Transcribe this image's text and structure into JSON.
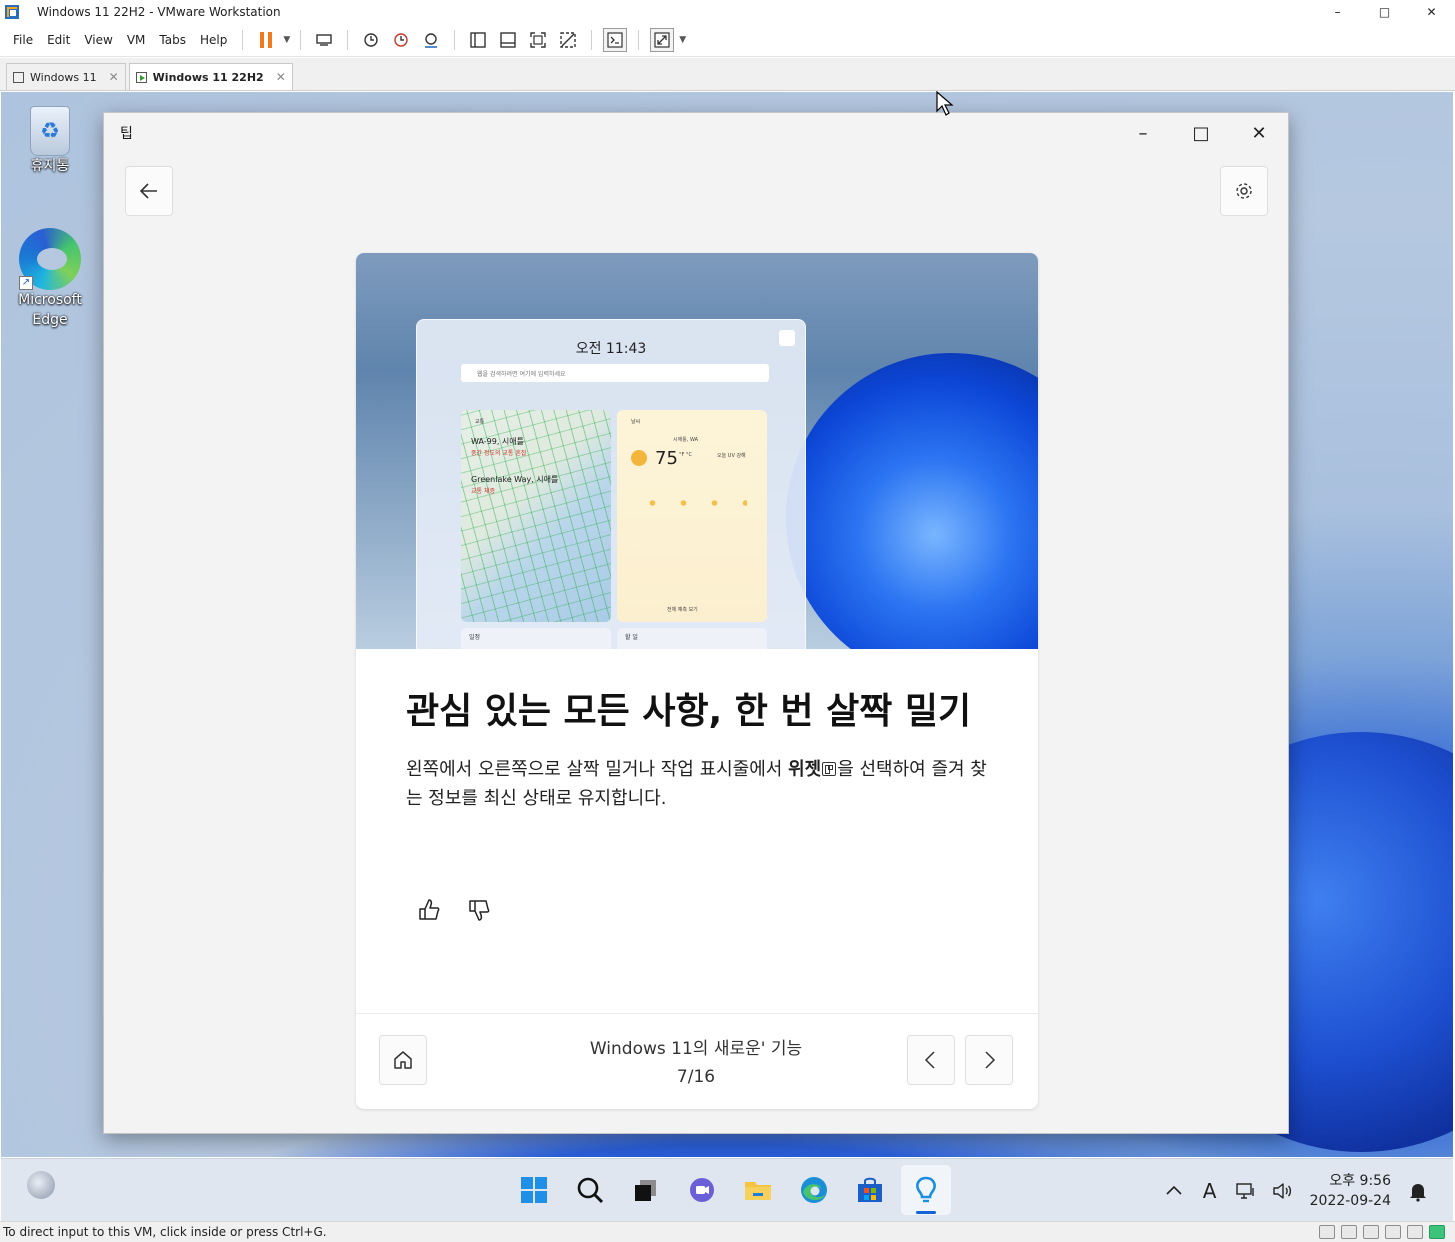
{
  "vm": {
    "window_title": "Windows 11 22H2 - VMware Workstation",
    "winctl": {
      "minimize": "–",
      "maximize": "□",
      "close": "✕"
    },
    "menus": [
      "File",
      "Edit",
      "View",
      "VM",
      "Tabs",
      "Help"
    ],
    "tabs": [
      {
        "label": "Windows 11",
        "close": "✕",
        "active": false
      },
      {
        "label": "Windows 11 22H2",
        "close": "✕",
        "active": true
      }
    ],
    "status_text": "To direct input to this VM, click inside or press Ctrl+G.",
    "accent_pause_color": "#f07a1e"
  },
  "desktop": {
    "icons": [
      {
        "label": "휴지통",
        "icon": "recycle-bin-icon"
      },
      {
        "label": "Microsoft Edge",
        "icon": "edge-icon"
      }
    ]
  },
  "tips": {
    "title": "팁",
    "winctl": {
      "minimize": "–",
      "maximize": "□",
      "close": "✕"
    },
    "hero": {
      "time": "오전 11:43",
      "search_placeholder": "웹을 검색하려면 여기에 입력하세요",
      "traffic_label": "교통",
      "traffic_road1": "WA-99, 시애틀",
      "traffic_road1_status": "중간 정도의 교통 혼잡",
      "traffic_road2": "Greenlake Way, 시애틀",
      "traffic_road2_status": "교통 체증",
      "weather_label": "날씨",
      "weather_location": "시애틀, WA",
      "weather_temp": "75",
      "weather_unit": "°F °C",
      "weather_uv": "오늘 UV 강해",
      "weather_more": "전체 예측 보기",
      "calendar_label": "일정",
      "todo_label": "할 일"
    },
    "heading": "관심 있는 모든 사항, 한 번 살짝 밀기",
    "body_before": "왼쪽에서 오른쪽으로 살짝 밀거나 작업 표시줄에서 ",
    "body_bold": "위젯",
    "body_after": "을 선택하여 즐겨 찾는 정보를 최신 상태로 유지합니다.",
    "collection": "Windows 11의 새로운' 기능",
    "page": "7/16"
  },
  "taskbar": {
    "apps": [
      "start-icon",
      "search-icon",
      "task-view-icon",
      "chat-icon",
      "file-explorer-icon",
      "edge-icon",
      "store-icon",
      "tips-icon"
    ],
    "active_app": "tips-icon",
    "clock_time": "오후 9:56",
    "clock_date": "2022-09-24",
    "ime": "A",
    "chevron": "^"
  }
}
